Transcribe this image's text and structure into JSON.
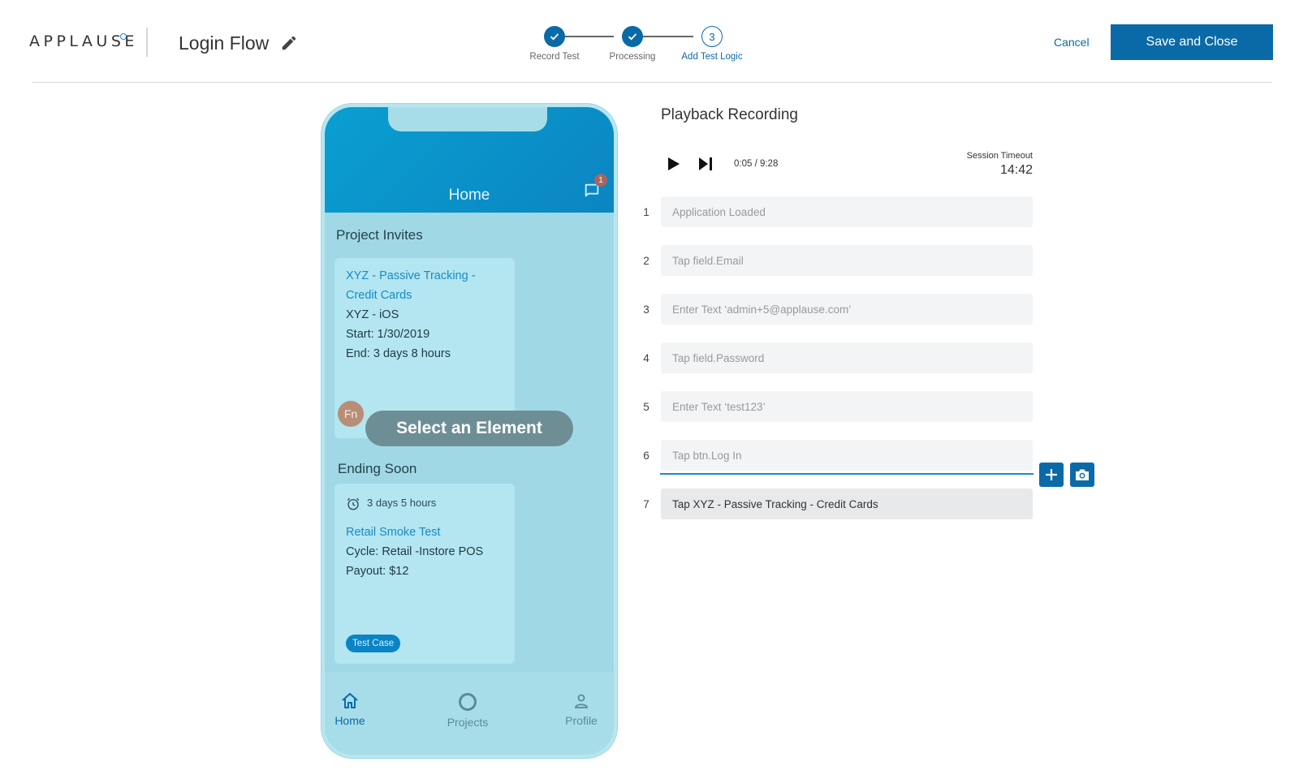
{
  "header": {
    "logo": "APPLAUSE",
    "test_name": "Login Flow",
    "steps": [
      {
        "label": "Record Test",
        "state": "done"
      },
      {
        "label": "Processing",
        "state": "done"
      },
      {
        "label": "Add Test Logic",
        "state": "current",
        "number": "3"
      }
    ],
    "cancel_label": "Cancel",
    "save_label": "Save and Close"
  },
  "phone": {
    "title": "Home",
    "chat_badge": "1",
    "invites_title": "Project Invites",
    "invite_card": {
      "link_line1": "XYZ - Passive Tracking -",
      "link_line2": "Credit Cards",
      "line1": "XYZ - iOS",
      "line2": "Start: 1/30/2019",
      "line3": "End: 3 days 8 hours",
      "avatar": "Fn"
    },
    "select_overlay": "Select an Element",
    "ending_title": "Ending Soon",
    "ending_card": {
      "timer": "3 days 5 hours",
      "link": "Retail Smoke Test",
      "line1": "Cycle: Retail -Instore POS",
      "line2": "Payout: $12",
      "tag": "Test Case"
    },
    "tabs": [
      {
        "label": "Home",
        "icon": "home-icon"
      },
      {
        "label": "Projects",
        "icon": "projects-circle-icon"
      },
      {
        "label": "Profile",
        "icon": "person-icon"
      }
    ]
  },
  "playback": {
    "title": "Playback Recording",
    "time": "0:05 / 9:28",
    "session_label": "Session Timeout",
    "session_value": "14:42",
    "steps": [
      {
        "num": "1",
        "text": "Application Loaded"
      },
      {
        "num": "2",
        "text": "Tap field.Email"
      },
      {
        "num": "3",
        "text": "Enter Text ‘admin+5@applause.com’"
      },
      {
        "num": "4",
        "text": "Tap field.Password"
      },
      {
        "num": "5",
        "text": "Enter Text ‘test123’"
      },
      {
        "num": "6",
        "text": "Tap btn.Log In"
      },
      {
        "num": "7",
        "text": "Tap XYZ - Passive Tracking - Credit Cards"
      }
    ]
  },
  "colors": {
    "accent": "#0a6aa8",
    "link": "#1a8ac6",
    "phone_header": "#0b85c2",
    "phone_body": "#a0d9e5"
  }
}
